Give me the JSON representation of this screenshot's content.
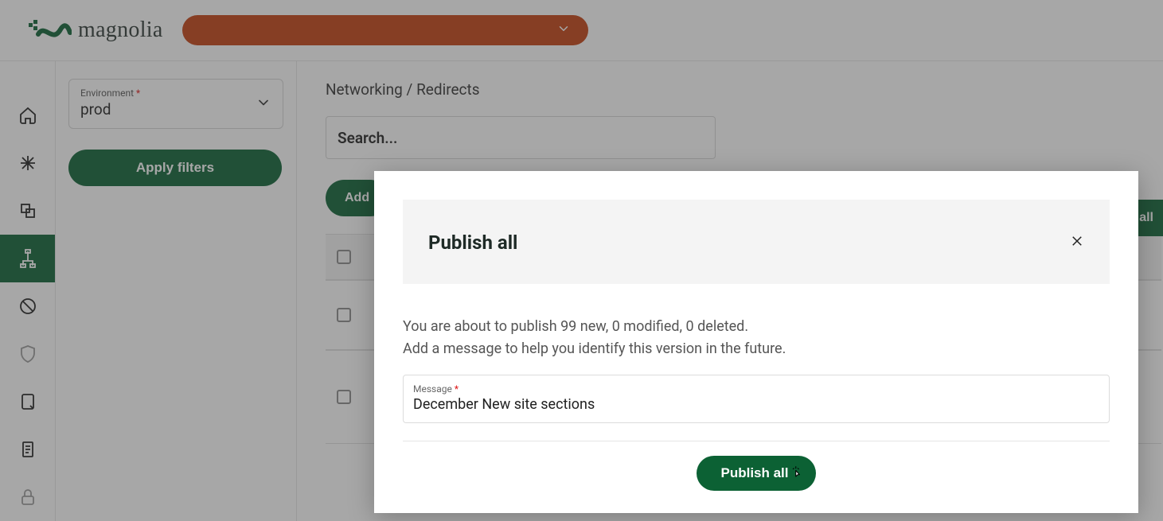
{
  "brand": {
    "name": "magnolia"
  },
  "topbar": {
    "pill_label": ""
  },
  "sidebar": {
    "environment_label": "Environment",
    "environment_value": "prod",
    "apply_label": "Apply filters"
  },
  "iconrail": {
    "items": [
      {
        "name": "home-icon"
      },
      {
        "name": "asterisk-icon"
      },
      {
        "name": "duplicate-icon"
      },
      {
        "name": "sitemap-icon",
        "active": true
      },
      {
        "name": "ban-icon"
      },
      {
        "name": "shield-icon"
      },
      {
        "name": "device-icon"
      },
      {
        "name": "note-icon"
      },
      {
        "name": "lock-icon"
      }
    ]
  },
  "main": {
    "breadcrumb": "Networking / Redirects",
    "search_placeholder": "Search...",
    "add_label": "Add",
    "publish_all_top_label": "n all"
  },
  "modal": {
    "title": "Publish all",
    "line1": "You are about to publish 99 new, 0 modified, 0 deleted.",
    "line2": "Add a message to help you identify this version in the future.",
    "message_label": "Message",
    "message_value": "December New site sections",
    "submit_label": "Publish all"
  }
}
